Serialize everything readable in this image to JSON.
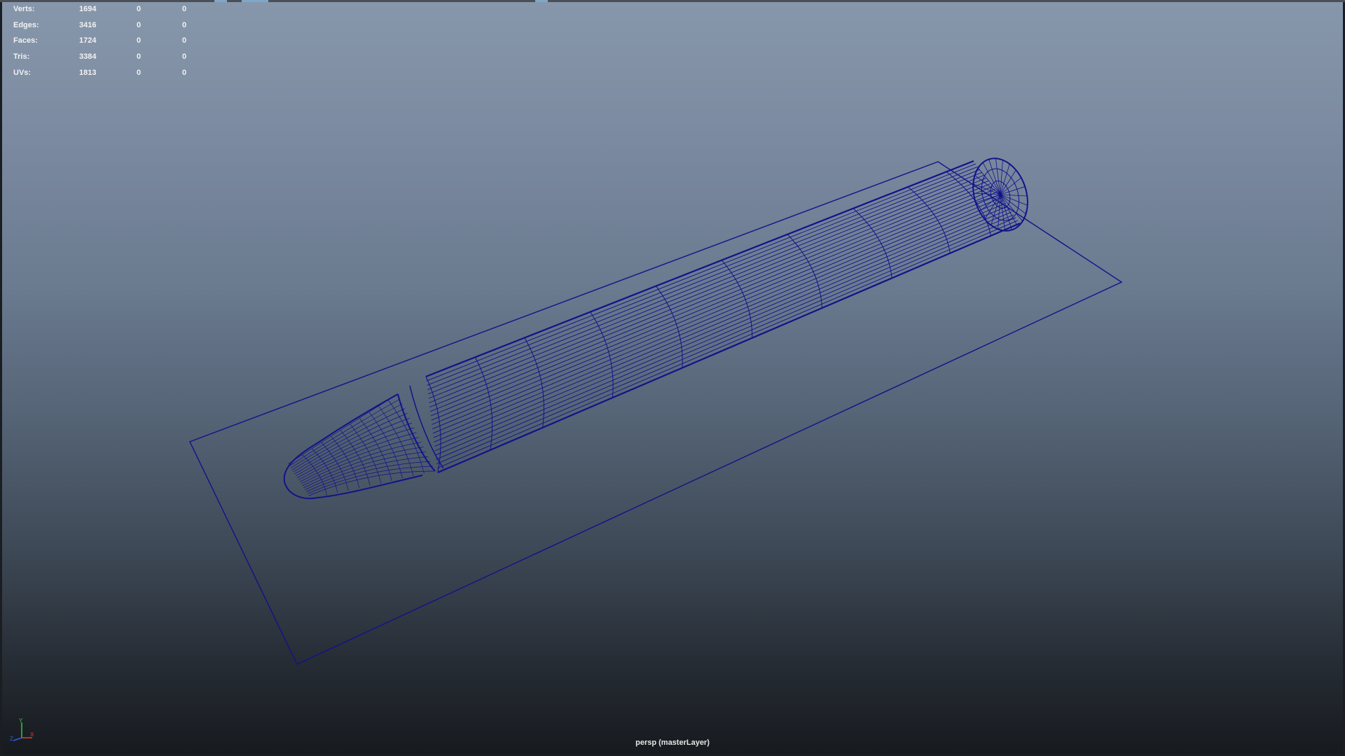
{
  "viewport": {
    "camera_label": "persp (masterLayer)"
  },
  "heads_up_display": {
    "rows": [
      {
        "label": "Verts:",
        "total": "1694",
        "selected": "0",
        "component": "0"
      },
      {
        "label": "Edges:",
        "total": "3416",
        "selected": "0",
        "component": "0"
      },
      {
        "label": "Faces:",
        "total": "1724",
        "selected": "0",
        "component": "0"
      },
      {
        "label": "Tris:",
        "total": "3384",
        "selected": "0",
        "component": "0"
      },
      {
        "label": "UVs:",
        "total": "1813",
        "selected": "0",
        "component": "0"
      }
    ]
  },
  "axis_indicator": {
    "y_label": "Y",
    "x_label": "X",
    "z_label": "Z"
  },
  "colors": {
    "wireframe": "#12128a",
    "hud_text": "#f2f2f2",
    "axis_y": "#2ecc40",
    "axis_x": "#e23b3b",
    "axis_z": "#2f5fe0"
  }
}
